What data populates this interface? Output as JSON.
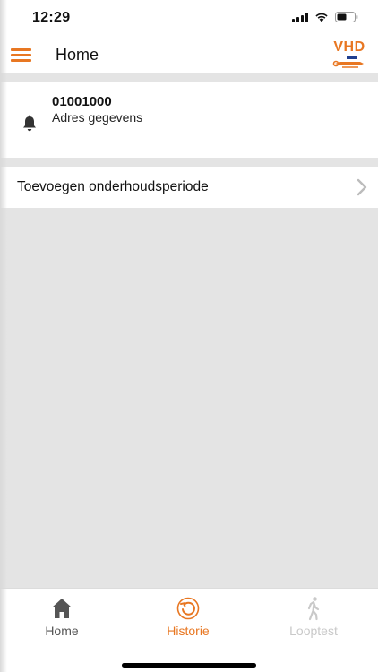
{
  "status_bar": {
    "time": "12:29",
    "icons": [
      "signal-icon",
      "wifi-icon",
      "battery-icon"
    ]
  },
  "header": {
    "title": "Home",
    "logo_text": "VHD",
    "menu_icon": "hamburger-menu-icon"
  },
  "address_card": {
    "code": "01001000",
    "address": "Adres gegevens",
    "icon": "bell-icon"
  },
  "maintenance": {
    "label": "Toevoegen onderhoudsperiode",
    "icon": "chevron-right-icon"
  },
  "tabs": [
    {
      "label": "Home",
      "icon": "home-icon",
      "state": "inactive"
    },
    {
      "label": "Historie",
      "icon": "history-icon",
      "state": "active"
    },
    {
      "label": "Looptest",
      "icon": "walk-icon",
      "state": "disabled"
    }
  ],
  "colors": {
    "accent": "#e87722",
    "band": "#e4e4e4",
    "disabled": "#c9c9c9",
    "logo_blue": "#1f3f8f"
  }
}
